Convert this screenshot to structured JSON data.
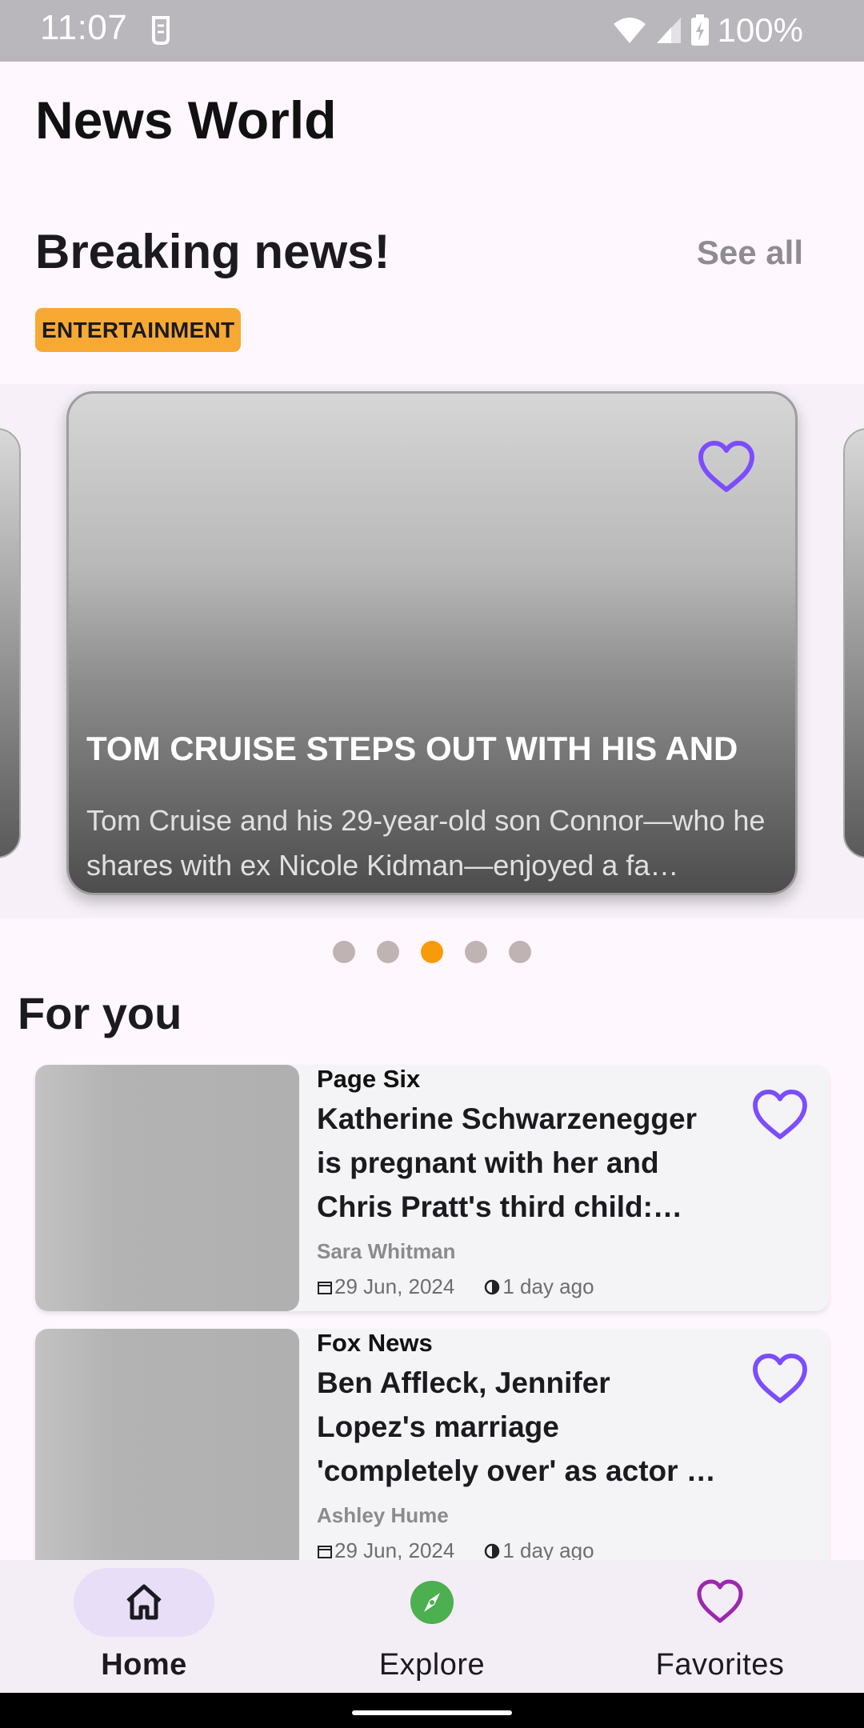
{
  "status_bar": {
    "time": "11:07",
    "battery": "100%",
    "icons": [
      "sim-icon",
      "wifi-icon",
      "signal-icon",
      "battery-icon"
    ]
  },
  "app_title": "News World",
  "breaking": {
    "title": "Breaking news!",
    "see_all": "See all",
    "category": "ENTERTAINMENT",
    "card": {
      "title": "TOM CRUISE STEPS OUT WITH HIS AND",
      "description": "Tom Cruise and his 29-year-old son Connor—who he shares with ex Nicole Kidman—enjoyed a fa…",
      "favorite_icon": "heart-outline-icon"
    },
    "carousel_pages": 5,
    "carousel_active_index": 2
  },
  "for_you": {
    "title": "For you",
    "articles": [
      {
        "source": "Page Six",
        "title": "Katherine Schwarzenegger is pregnant with her and Chris Pratt's third child: re…",
        "author": "Sara Whitman",
        "date": "29 Jun, 2024",
        "ago": "1 day ago"
      },
      {
        "source": "Fox News",
        "title": "Ben Affleck, Jennifer Lopez's marriage 'completely over' as actor …",
        "author": "Ashley Hume",
        "date": "29 Jun, 2024",
        "ago": "1 day ago"
      }
    ]
  },
  "bottom_nav": {
    "items": [
      {
        "label": "Home",
        "icon": "home-icon",
        "selected": true
      },
      {
        "label": "Explore",
        "icon": "compass-icon",
        "selected": false
      },
      {
        "label": "Favorites",
        "icon": "heart-icon",
        "selected": false
      }
    ]
  },
  "colors": {
    "accent_purple": "#7c4dff",
    "chip_orange": "#f7a934",
    "dot_active": "#f99a0a",
    "explore_green": "#4caf50",
    "favorites_purple": "#9c27b0"
  }
}
